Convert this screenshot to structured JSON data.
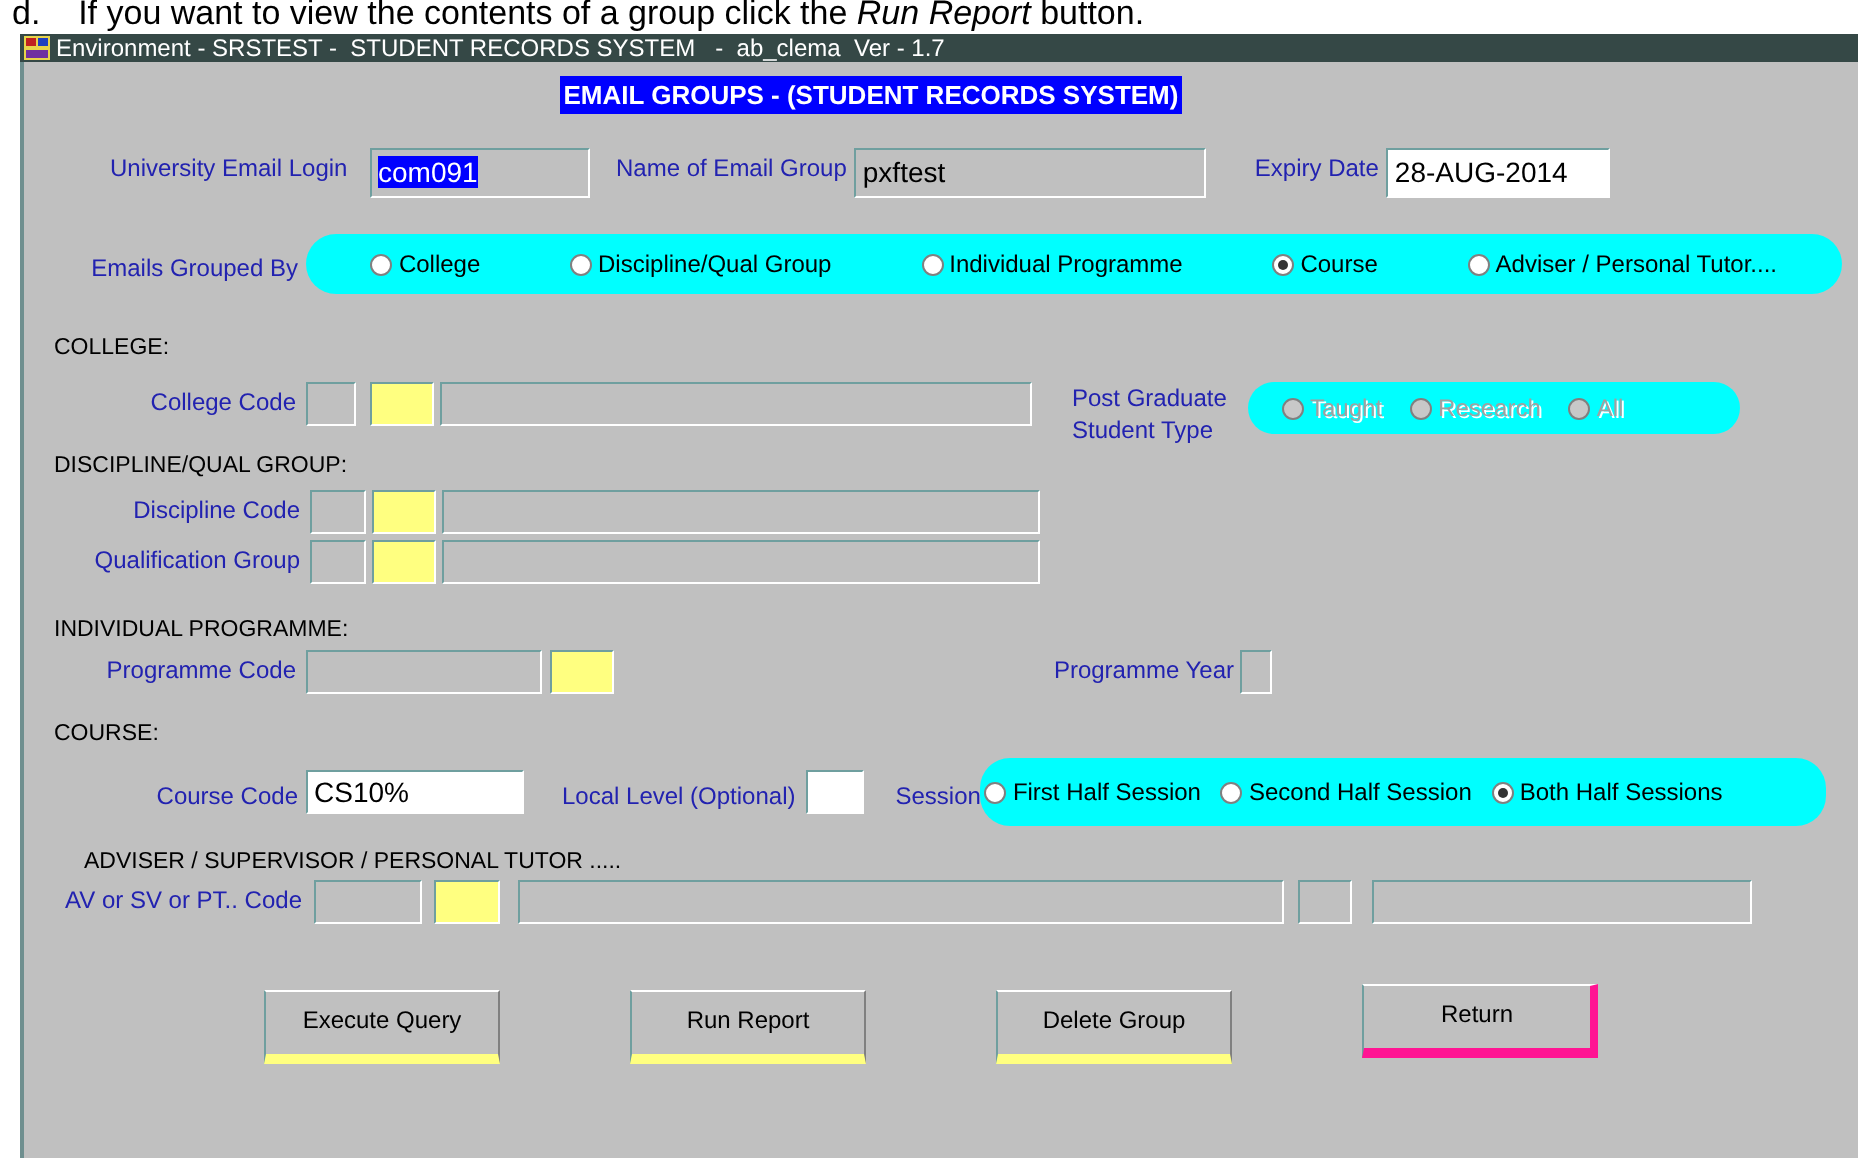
{
  "doc_line": "d.    If you want to view the contents of a group click the *Run Report* button.",
  "window": {
    "title": "Environment - SRSTEST -  STUDENT RECORDS SYSTEM   -  ab_clema  Ver - 1.7"
  },
  "heading": "EMAIL GROUPS - (STUDENT RECORDS SYSTEM)",
  "login": {
    "label": "University Email Login",
    "value": "com091",
    "highlighted": true
  },
  "group_name": {
    "label": "Name of Email Group",
    "value": "pxftest"
  },
  "expiry": {
    "label": "Expiry Date",
    "value": "28-AUG-2014"
  },
  "grouped_by": {
    "label": "Emails Grouped By",
    "options": [
      {
        "label": "College",
        "selected": false
      },
      {
        "label": "Discipline/Qual Group",
        "selected": false
      },
      {
        "label": "Individual Programme",
        "selected": false
      },
      {
        "label": "Course",
        "selected": true
      },
      {
        "label": "Adviser / Personal Tutor....",
        "selected": false
      }
    ]
  },
  "college": {
    "heading": "COLLEGE:",
    "code_label": "College Code",
    "student_type_label": "Post Graduate Student Type",
    "student_type_options": [
      {
        "label": "Taught",
        "selected": false,
        "disabled": true
      },
      {
        "label": "Research",
        "selected": false,
        "disabled": true
      },
      {
        "label": "All",
        "selected": false,
        "disabled": true
      }
    ]
  },
  "discipline": {
    "heading": "DISCIPLINE/QUAL GROUP:",
    "discipline_label": "Discipline Code",
    "qualification_label": "Qualification Group"
  },
  "programme": {
    "heading": "INDIVIDUAL PROGRAMME:",
    "code_label": "Programme Code",
    "year_label": "Programme Year"
  },
  "course": {
    "heading": "COURSE:",
    "code_label": "Course Code",
    "code_value": "CS10%",
    "level_label": "Local Level (Optional)",
    "session_label": "Session",
    "session_options": [
      {
        "label": "First Half Session",
        "selected": false
      },
      {
        "label": "Second Half Session",
        "selected": false
      },
      {
        "label": "Both Half Sessions",
        "selected": true
      }
    ]
  },
  "adviser": {
    "heading": "ADVISER / SUPERVISOR / PERSONAL TUTOR .....",
    "code_label": "AV or SV or PT.. Code"
  },
  "buttons": [
    {
      "label": "Execute Query",
      "focused": false
    },
    {
      "label": "Run Report",
      "focused": false
    },
    {
      "label": "Delete Group",
      "focused": false
    },
    {
      "label": "Return",
      "focused": true
    }
  ]
}
